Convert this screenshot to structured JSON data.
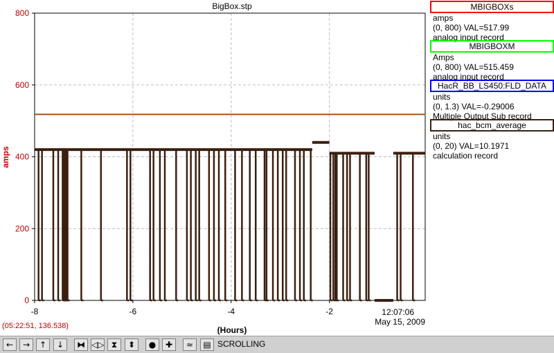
{
  "window": {
    "title": "BigBox.stp"
  },
  "chart_data": {
    "type": "line",
    "title": "BigBox.stp",
    "ylabel": "amps",
    "xlabel": "(Hours)",
    "xlim": [
      -8.0,
      -0.05
    ],
    "ylim": [
      0,
      800
    ],
    "grid": true,
    "x_ticks": [
      -8,
      -6,
      -4,
      -2
    ],
    "y_ticks": [
      0,
      200,
      400,
      600,
      800
    ],
    "time_label": "12:07:06",
    "date_label": "May 15, 2009",
    "series": [
      {
        "name": "MBIGBOXs",
        "color": "#a6531b",
        "note_x": [
          -8.0,
          -0.05
        ],
        "values": [
          517.99,
          517.99
        ]
      },
      {
        "name": "hac_bcm_average",
        "color": "#3b1f10",
        "levels": [
          {
            "from": -8.0,
            "to": -2.35,
            "value": 420
          },
          {
            "from": -2.35,
            "to": -2.0,
            "value": 440
          },
          {
            "from": -2.0,
            "to": -1.08,
            "value": 410
          },
          {
            "from": -1.08,
            "to": -0.7,
            "value": 0
          },
          {
            "from": -0.7,
            "to": -0.05,
            "value": 410
          }
        ],
        "dropouts_to_zero": [
          -7.92,
          -7.85,
          -7.62,
          -7.52,
          -7.43,
          -7.41,
          -7.39,
          -7.36,
          -7.33,
          -7.05,
          -6.65,
          -6.12,
          -6.05,
          -5.65,
          -5.58,
          -5.45,
          -5.35,
          -5.12,
          -4.9,
          -4.82,
          -4.72,
          -4.65,
          -4.45,
          -4.35,
          -4.25,
          -4.12,
          -3.92,
          -3.78,
          -3.62,
          -3.5,
          -3.32,
          -3.28,
          -3.15,
          -3.05,
          -2.95,
          -2.88,
          -2.7,
          -2.6,
          -2.52,
          -2.38,
          -1.98,
          -1.92,
          -1.88,
          -1.85,
          -1.72,
          -1.64,
          -1.58,
          -1.38,
          -1.25,
          -1.2,
          -0.62,
          -0.55,
          -0.3
        ]
      }
    ]
  },
  "legend": [
    {
      "name": "MBIGBOXs",
      "color": "#ff0000",
      "units": "amps",
      "range_value": "(0, 800)  VAL=517.99",
      "type": "analog input record"
    },
    {
      "name": "MBIGBOXM",
      "color": "#00ff00",
      "units": "Amps",
      "range_value": "(0, 800)  VAL=515.459",
      "type": "analog input record"
    },
    {
      "name": "HacR_BB_LS450:FLD_DATA",
      "color": "#0000ff",
      "units": "units",
      "range_value": "(0, 1.3)  VAL=-0.29006",
      "type": "Multiple Output Sub record"
    },
    {
      "name": "hac_bcm_average",
      "color": "#3b1f10",
      "units": "units",
      "range_value": "(0, 20)  VAL=10.1971",
      "type": "calculation record"
    }
  ],
  "status": {
    "coordinates": "(05:22:51, 136.538)",
    "mode": "SCROLLING"
  },
  "toolbar": {
    "buttons": [
      {
        "name": "scroll-left-icon",
        "glyph": "←"
      },
      {
        "name": "scroll-right-icon",
        "glyph": "→"
      },
      {
        "name": "scroll-up-icon",
        "glyph": "↑"
      },
      {
        "name": "scroll-down-icon",
        "glyph": "↓"
      },
      {
        "name": "zoom-in-horizontal-icon",
        "glyph": "⧓"
      },
      {
        "name": "zoom-out-horizontal-icon",
        "glyph": "◁▷"
      },
      {
        "name": "zoom-in-vertical-icon",
        "glyph": "⧗"
      },
      {
        "name": "zoom-out-vertical-icon",
        "glyph": "⬍"
      },
      {
        "name": "autoscale-icon",
        "glyph": "●"
      },
      {
        "name": "reset-icon",
        "glyph": "✚"
      },
      {
        "name": "configure-icon",
        "glyph": "≈"
      },
      {
        "name": "scrolling-mode-icon",
        "glyph": "▤"
      }
    ]
  }
}
